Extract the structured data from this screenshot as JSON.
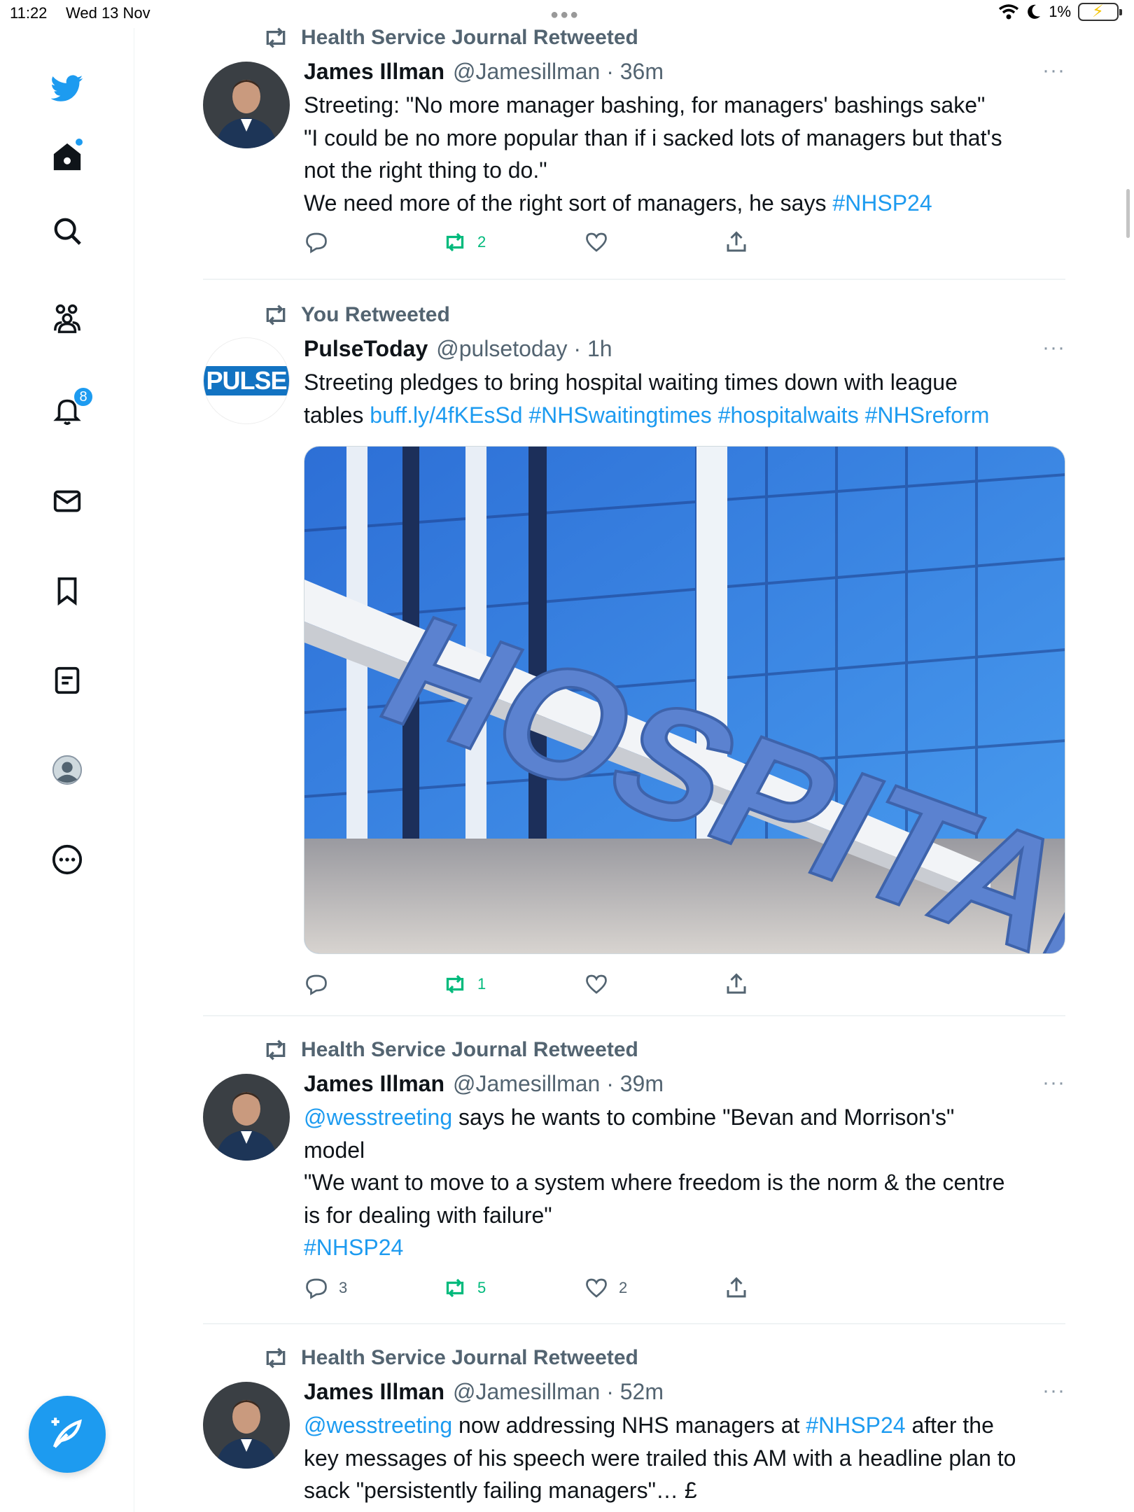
{
  "status": {
    "time": "11:22",
    "date": "Wed 13 Nov",
    "battery": "1%"
  },
  "sidebar": {
    "notification_count": "8"
  },
  "tweets": [
    {
      "context": "Health Service Journal Retweeted",
      "name": "James Illman",
      "handle": "@Jamesillman",
      "time": "36m",
      "lines": [
        "Streeting: \"No more manager bashing, for managers' bashings sake\"",
        "\"I could be no more popular than if i sacked lots of managers but that's",
        "not the right thing to do.\"",
        "We need more of the right sort of managers, he says "
      ],
      "hashtag": "#NHSP24",
      "replies": "",
      "retweets": "2",
      "likes": ""
    },
    {
      "context": "You Retweeted",
      "name": "PulseToday",
      "handle": "@pulsetoday",
      "time": "1h",
      "avatar_text": "PULSE",
      "line1": "Streeting pledges to bring hospital waiting times down with league",
      "line2_prefix": "tables ",
      "links": [
        "buff.ly/4fKEsSd",
        "#NHSwaitingtimes",
        "#hospitalwaits",
        "#NHSreform"
      ],
      "image_text": "HOSPITAL",
      "replies": "",
      "retweets": "1",
      "likes": ""
    },
    {
      "context": "Health Service Journal Retweeted",
      "name": "James Illman",
      "handle": "@Jamesillman",
      "time": "39m",
      "mention": "@wesstreeting",
      "line1_rest": " says he wants to combine \"Bevan and Morrison's\"",
      "line2": "model",
      "line3": "\"We want to move to a system where freedom is the norm & the centre",
      "line4": "is for dealing with failure\"",
      "hashtag": "#NHSP24",
      "replies": "3",
      "retweets": "5",
      "likes": "2"
    },
    {
      "context": "Health Service Journal Retweeted",
      "name": "James Illman",
      "handle": "@Jamesillman",
      "time": "52m",
      "mention": "@wesstreeting",
      "line1_mid": " now addressing NHS managers at ",
      "hashtag": "#NHSP24",
      "line1_end": " after the",
      "line2": "key messages of his speech were trailed this AM with a headline plan to",
      "line3": "sack \"persistently failing managers\"…  £"
    }
  ]
}
